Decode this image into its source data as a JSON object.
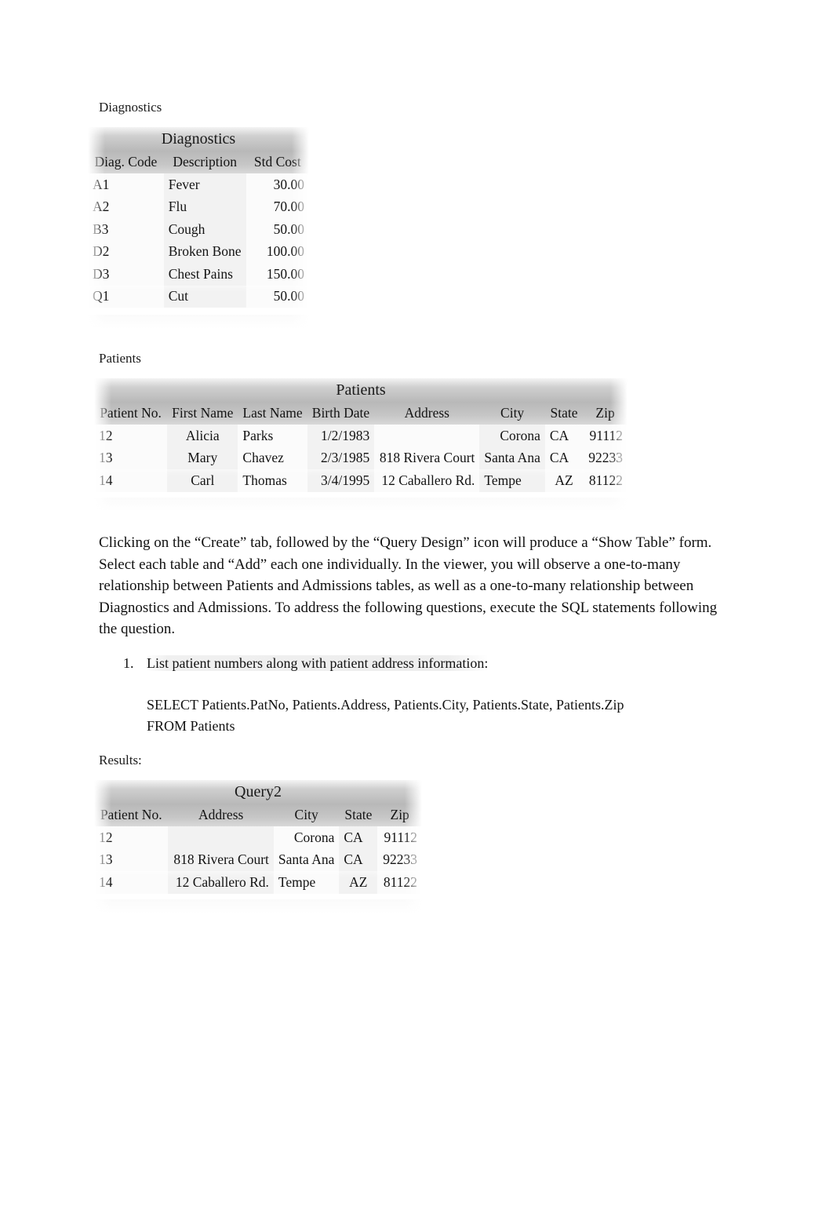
{
  "document": {
    "labels": {
      "diagnostics_caption": "Diagnostics",
      "patients_caption": "Patients",
      "results_caption": "Results:"
    },
    "paragraph": "Clicking on the “Create” tab, followed by the “Query Design” icon will produce a “Show Table” form. Select each table and “Add” each one individually.  In the viewer, you will observe a one-to-many relationship between Patients and Admissions tables, as well as a one-to-many relationship between Diagnostics and Admissions. To address the following questions, execute the SQL statements following the question.",
    "question": {
      "number": "1.",
      "text": "List patient numbers along with patient address information:"
    },
    "sql": {
      "line1": "SELECT Patients.PatNo, Patients.Address, Patients.City, Patients.State, Patients.Zip",
      "line2": "FROM Patients"
    }
  },
  "tables": {
    "diagnostics": {
      "title": "Diagnostics",
      "columns": [
        "Diag. Code",
        "Description",
        "Std Cost"
      ],
      "rows": [
        [
          "A1",
          "Fever",
          "30.00"
        ],
        [
          "A2",
          "Flu",
          "70.00"
        ],
        [
          "B3",
          "Cough",
          "50.00"
        ],
        [
          "D2",
          "Broken Bone",
          "100.00"
        ],
        [
          "D3",
          "Chest Pains",
          "150.00"
        ],
        [
          "Q1",
          "Cut",
          "50.00"
        ]
      ]
    },
    "patients": {
      "title": "Patients",
      "columns": [
        "Patient No.",
        "First Name",
        "Last Name",
        "Birth Date",
        "Address",
        "City",
        "State",
        "Zip"
      ],
      "rows": [
        [
          "12",
          "Alicia",
          "Parks",
          "1/2/1983",
          "",
          "Corona",
          "CA",
          "91112"
        ],
        [
          "13",
          "Mary",
          "Chavez",
          "2/3/1985",
          "818 Rivera Court",
          "Santa Ana",
          "CA",
          "92233"
        ],
        [
          "14",
          "Carl",
          "Thomas",
          "3/4/1995",
          "12 Caballero Rd.",
          "Tempe",
          "AZ",
          "81122"
        ]
      ]
    },
    "query2": {
      "title": "Query2",
      "columns": [
        "Patient No.",
        "Address",
        "City",
        "State",
        "Zip"
      ],
      "rows": [
        [
          "12",
          "",
          "Corona",
          "CA",
          "91112"
        ],
        [
          "13",
          "818 Rivera Court",
          "Santa Ana",
          "CA",
          "92233"
        ],
        [
          "14",
          "12 Caballero Rd.",
          "Tempe",
          "AZ",
          "81122"
        ]
      ]
    }
  }
}
